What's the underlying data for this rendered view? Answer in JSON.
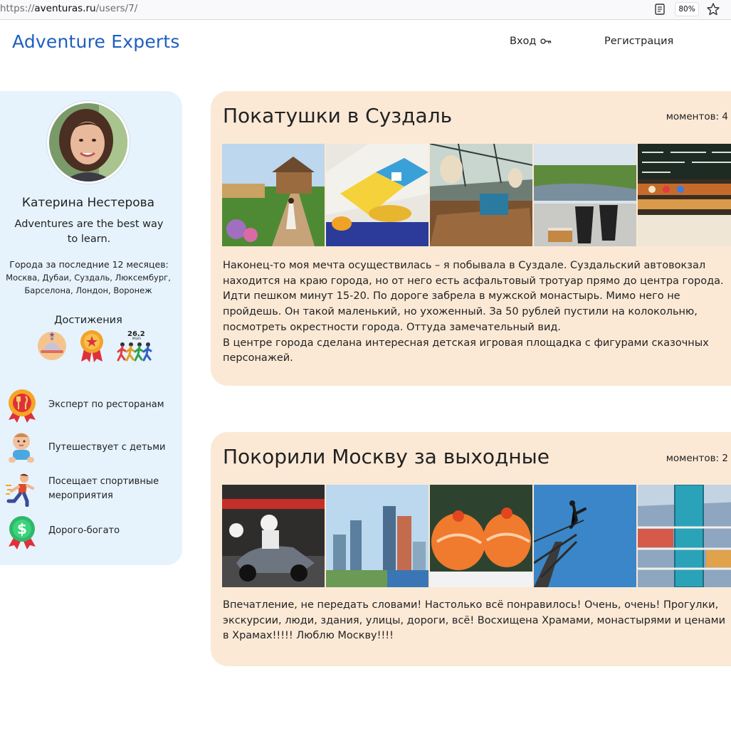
{
  "browser": {
    "url_scheme": "https://",
    "url_host": "aventuras.ru",
    "url_path": "/users/7/",
    "zoom": "80%",
    "reader_icon": "reader-view-icon",
    "bookmark_icon": "star-outline-icon"
  },
  "header": {
    "brand": "Adventure Experts",
    "login_label": "Вход",
    "login_icon": "key-icon",
    "register_label": "Регистрация"
  },
  "profile": {
    "name": "Катерина Нестерова",
    "motto": "Adventures are the best way to learn.",
    "cities_title": "Города за последние 12 месяцев:",
    "cities": "Москва, Дубаи, Суздаль, Люксембург, Барселона, Лондон, Воронеж",
    "achievements_title": "Достижения",
    "achievement_icons": [
      "food-cloche-icon",
      "ribbon-medal-icon",
      "marathon-runners-icon"
    ],
    "badges": [
      {
        "label": "Эксперт по ресторанам",
        "icon": "restaurant-medal-icon"
      },
      {
        "label": "Путешествует с детьми",
        "icon": "baby-icon"
      },
      {
        "label": "Посещает спортивные мероприятия",
        "icon": "runner-icon"
      },
      {
        "label": "Дорого-богато",
        "icon": "dollar-medal-icon"
      }
    ]
  },
  "posts": [
    {
      "title": "Покатушки в Суздаль",
      "moments": "моментов: 4",
      "photos": [
        "suzdal-garden-path",
        "hotel-room",
        "cafe-interior",
        "river-view-coffee",
        "shop-shelves"
      ],
      "text": "Наконец-то моя мечта осуществилась – я побывала в Суздале. Суздальский автовокзал находится на краю города, но от него есть асфальтовый тротуар прямо до центра города. Идти пешком минут 15-20. По дороге забрела в мужской монастырь. Мимо него не пройдешь. Он такой маленький, но ухоженный. За 50 рублей пустили на колокольню, посмотреть окрестности города. Оттуда замечательный вид.\nВ центре города сделана интересная детская игровая площадка с фигурами сказочных персонажей."
    },
    {
      "title": "Покорили Москву за выходные",
      "moments": "моментов: 2",
      "photos": [
        "karting",
        "moscow-city",
        "salmon-rolls",
        "bungee-jump",
        "aquarium-mall"
      ],
      "text": "Впечатление, не передать словами! Настолько всё понравилось! Очень, очень! Прогулки, экскурсии, люди, здания, улицы, дороги, всё! Восхищена Храмами, монастырями и ценами в Храмах!!!!! Люблю Москву!!!!"
    }
  ],
  "colors": {
    "brand": "#1e5fbf",
    "sidebar_bg": "#e6f3fd",
    "card_bg": "#fbe9d6"
  }
}
